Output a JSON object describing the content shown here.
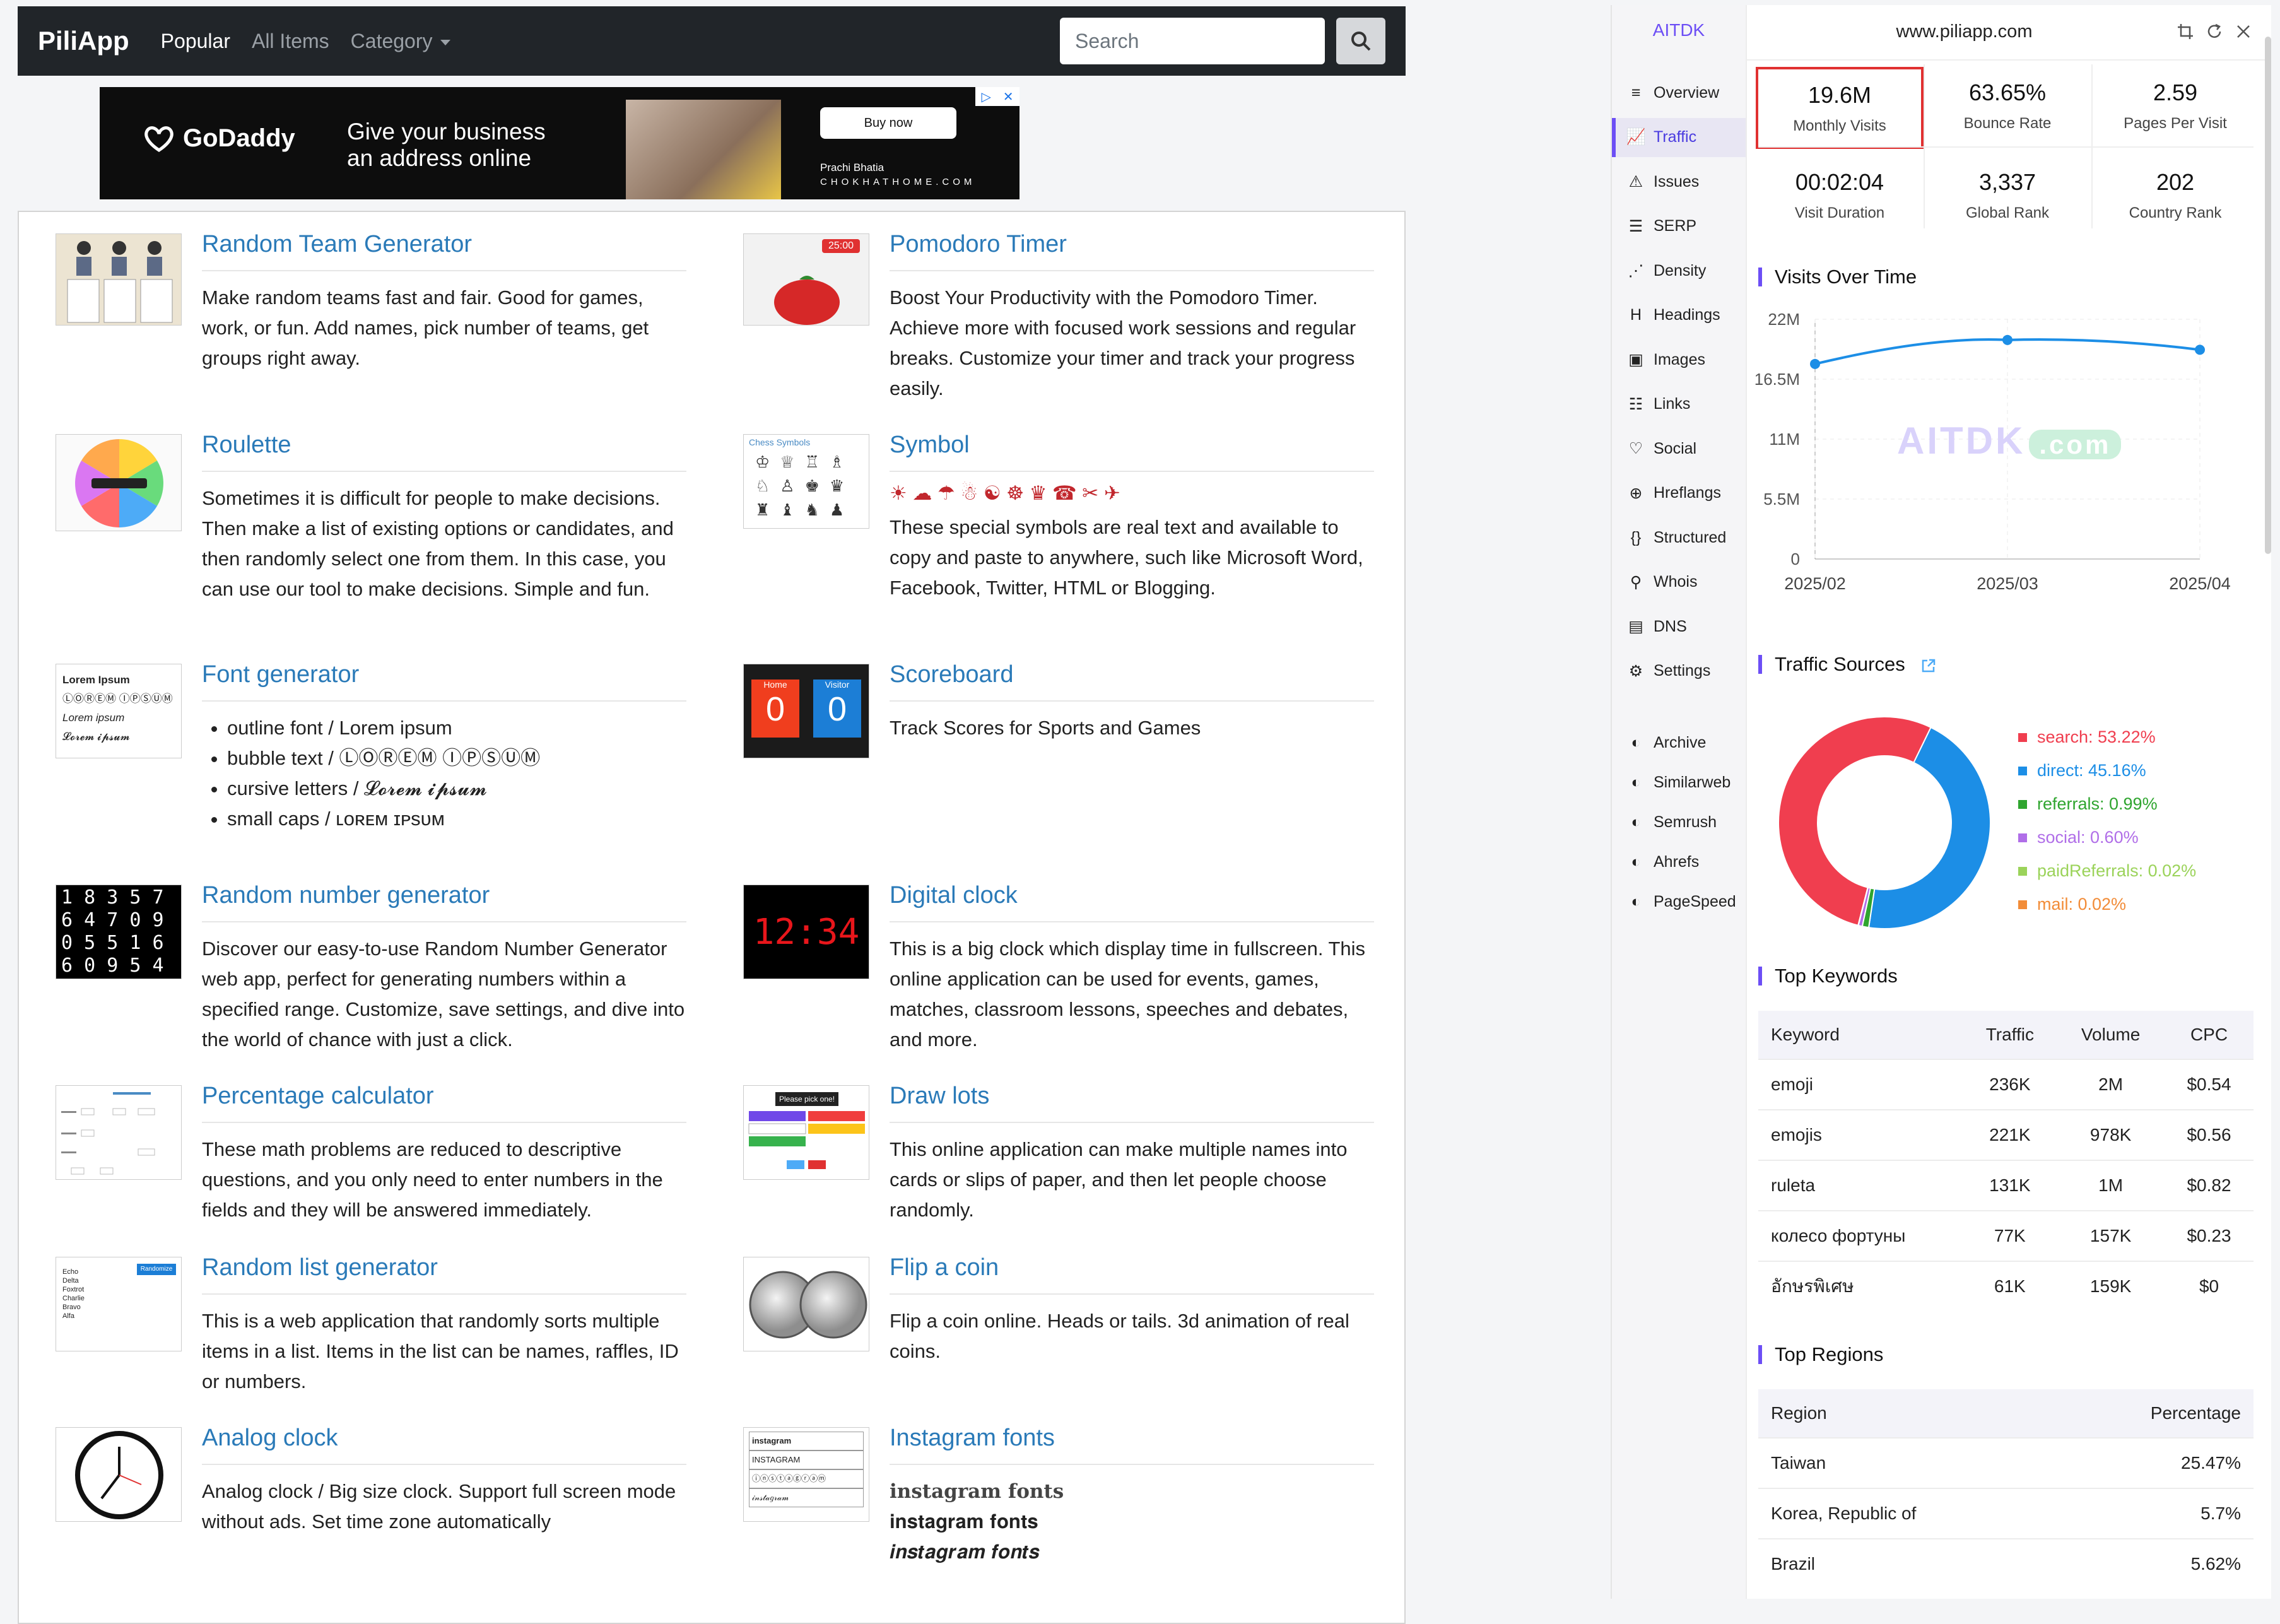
{
  "navbar": {
    "brand": "PiliApp",
    "links": [
      "Popular",
      "All Items",
      "Category"
    ],
    "search_placeholder": "Search"
  },
  "ad": {
    "brand": "GoDaddy",
    "headline": "Give your business an address online",
    "cta": "Buy now",
    "caption_name": "Prachi Bhatia",
    "caption_site": "CHOKHATHOME.COM"
  },
  "items": [
    {
      "title": "Random Team Generator",
      "desc": "Make random teams fast and fair. Good for games, work, or fun. Add names, pick number of teams, get groups right away."
    },
    {
      "title": "Pomodoro Timer",
      "desc": "Boost Your Productivity with the Pomodoro Timer. Achieve more with focused work sessions and regular breaks. Customize your timer and track your progress easily.",
      "thumb_time": "25:00"
    },
    {
      "title": "Roulette",
      "desc": "Sometimes it is difficult for people to make decisions. Then make a list of existing options or candidates, and then randomly select one from them. In this case, you can use our tool to make decisions. Simple and fun."
    },
    {
      "title": "Symbol",
      "symbols": "☀ ☁ ☂ ☃ ☯ ☸ ♛ ☎ ✂ ✈",
      "desc": "These special symbols are real text and available to copy and paste to anywhere, such like Microsoft Word, Facebook, Twitter, HTML or Blogging.",
      "thumb_label": "Chess Symbols"
    },
    {
      "title": "Font generator",
      "bullets": [
        "outline font / Lorem ipsum",
        "bubble text / ⓁⓄⓇⒺⓂ ⒾⓅⓈⓊⓂ",
        "cursive letters / 𝓛𝓸𝓻𝓮𝓶 𝓲𝓹𝓼𝓾𝓶",
        "small caps / ʟᴏʀᴇᴍ ɪᴘsᴜᴍ"
      ],
      "thumb_lines": [
        "Lorem Ipsum",
        "ⓁⓄⓇⒺⓂ ⒾⓅⓈⓊⓂ",
        "Lorem ipsum",
        "𝓛𝓸𝓻𝓮𝓶 𝓲𝓹𝓼𝓾𝓶"
      ]
    },
    {
      "title": "Scoreboard",
      "desc": "Track Scores for Sports and Games",
      "thumb_home": "Home",
      "thumb_visitor": "Visitor",
      "thumb_score": "0"
    },
    {
      "title": "Random number generator",
      "desc": "Discover our easy-to-use Random Number Generator web app, perfect for generating numbers within a specified range. Customize, save settings, and dive into the world of chance with just a click.",
      "thumb_rows": [
        "1 8 3 5 7",
        "6 4 7 0 9",
        "0 5 5 1 6",
        "6 0 9 5 4"
      ]
    },
    {
      "title": "Digital clock",
      "desc": "This is a big clock which display time in fullscreen. This online application can be used for events, games, matches, classroom lessons, speeches and debates, and more.",
      "thumb_time": "12:34"
    },
    {
      "title": "Percentage calculator",
      "desc": "These math problems are reduced to descriptive questions, and you only need to enter numbers in the fields and they will be answered immediately."
    },
    {
      "title": "Draw lots",
      "desc": "This online application can make multiple names into cards or slips of paper, and then let people choose randomly.",
      "thumb_label": "Please pick one!"
    },
    {
      "title": "Random list generator",
      "desc": "This is a web application that randomly sorts multiple items in a list. Items in the list can be names, raffles, ID or numbers.",
      "thumb_list": [
        "Echo",
        "Delta",
        "Foxtrot",
        "Charlie",
        "Bravo",
        "Alfa"
      ],
      "thumb_btn": "Randomize"
    },
    {
      "title": "Flip a coin",
      "desc": "Flip a coin online. Heads or tails. 3d animation of real coins."
    },
    {
      "title": "Analog clock",
      "desc": "Analog clock / Big size clock. Support full screen mode without ads. Set time zone automatically"
    },
    {
      "title": "Instagram fonts",
      "lines": [
        "instagram fonts",
        "𝐢𝐧𝐬𝐭𝐚𝐠𝐫𝐚𝐦 𝐟𝐨𝐧𝐭𝐬",
        "𝒊𝒏𝒔𝒕𝒂𝒈𝒓𝒂𝒎 𝒇𝒐𝒏𝒕𝒔"
      ],
      "thumb_lines": [
        "instagram",
        "INSTAGRAM",
        "ⓘⓝⓢⓣⓐⓖⓡⓐⓜ",
        "𝒾𝓃𝓈𝓉𝒶𝑔𝓇𝒶𝓂"
      ]
    }
  ],
  "aitdk": {
    "brand": "AITDK",
    "domain": "www.piliapp.com",
    "nav": [
      "Overview",
      "Traffic",
      "Issues",
      "SERP",
      "Density",
      "Headings",
      "Images",
      "Links",
      "Social",
      "Hreflangs",
      "Structured",
      "Whois",
      "DNS",
      "Settings"
    ],
    "nav_icons": [
      "list-icon",
      "line-chart-icon",
      "warning-icon",
      "serp-icon",
      "density-icon",
      "heading-icon",
      "image-icon",
      "links-icon",
      "social-icon",
      "globe-icon",
      "braces-icon",
      "user-search-icon",
      "server-icon",
      "gear-icon"
    ],
    "ext": [
      "Archive",
      "Similarweb",
      "Semrush",
      "Ahrefs",
      "PageSpeed"
    ],
    "metrics": [
      {
        "value": "19.6M",
        "label": "Monthly Visits"
      },
      {
        "value": "63.65%",
        "label": "Bounce Rate"
      },
      {
        "value": "2.59",
        "label": "Pages Per Visit"
      },
      {
        "value": "00:02:04",
        "label": "Visit Duration"
      },
      {
        "value": "3,337",
        "label": "Global Rank"
      },
      {
        "value": "202",
        "label": "Country Rank"
      }
    ],
    "sections": {
      "visits": "Visits Over Time",
      "sources": "Traffic Sources",
      "keywords": "Top Keywords",
      "regions": "Top Regions"
    },
    "watermark": "AITDK",
    "watermark_tag": ".com",
    "keywords_header": [
      "Keyword",
      "Traffic",
      "Volume",
      "CPC"
    ],
    "keywords": [
      [
        "emoji",
        "236K",
        "2M",
        "$0.54"
      ],
      [
        "emojis",
        "221K",
        "978K",
        "$0.56"
      ],
      [
        "ruleta",
        "131K",
        "1M",
        "$0.82"
      ],
      [
        "колесо фортуны",
        "77K",
        "157K",
        "$0.23"
      ],
      [
        "อักษรพิเศษ",
        "61K",
        "159K",
        "$0"
      ]
    ],
    "regions_header": [
      "Region",
      "Percentage"
    ],
    "regions": [
      [
        "Taiwan",
        "25.47%"
      ],
      [
        "Korea, Republic of",
        "5.7%"
      ],
      [
        "Brazil",
        "5.62%"
      ]
    ]
  },
  "chart_data": [
    {
      "type": "line",
      "title": "Visits Over Time",
      "x": [
        "2025/02",
        "2025/03",
        "2025/04"
      ],
      "series": [
        {
          "values": [
            17.9,
            20.1,
            19.2
          ]
        }
      ],
      "ylim": [
        0,
        22
      ],
      "yticks": [
        "0",
        "5.5M",
        "11M",
        "16.5M",
        "22M"
      ],
      "color": "#1c8ee6",
      "grid": true
    },
    {
      "type": "pie",
      "title": "Traffic Sources",
      "labels": [
        "search",
        "direct",
        "referrals",
        "social",
        "paidReferrals",
        "mail"
      ],
      "values": [
        53.22,
        45.16,
        0.99,
        0.6,
        0.02,
        0.02
      ],
      "display": [
        "search: 53.22%",
        "direct: 45.16%",
        "referrals: 0.99%",
        "social: 0.60%",
        "paidReferrals: 0.02%",
        "mail: 0.02%"
      ],
      "colors": [
        "#f03e4f",
        "#1c8ee6",
        "#2fa52f",
        "#b06ee8",
        "#9bd35a",
        "#f28c38"
      ],
      "legend": "right"
    }
  ]
}
